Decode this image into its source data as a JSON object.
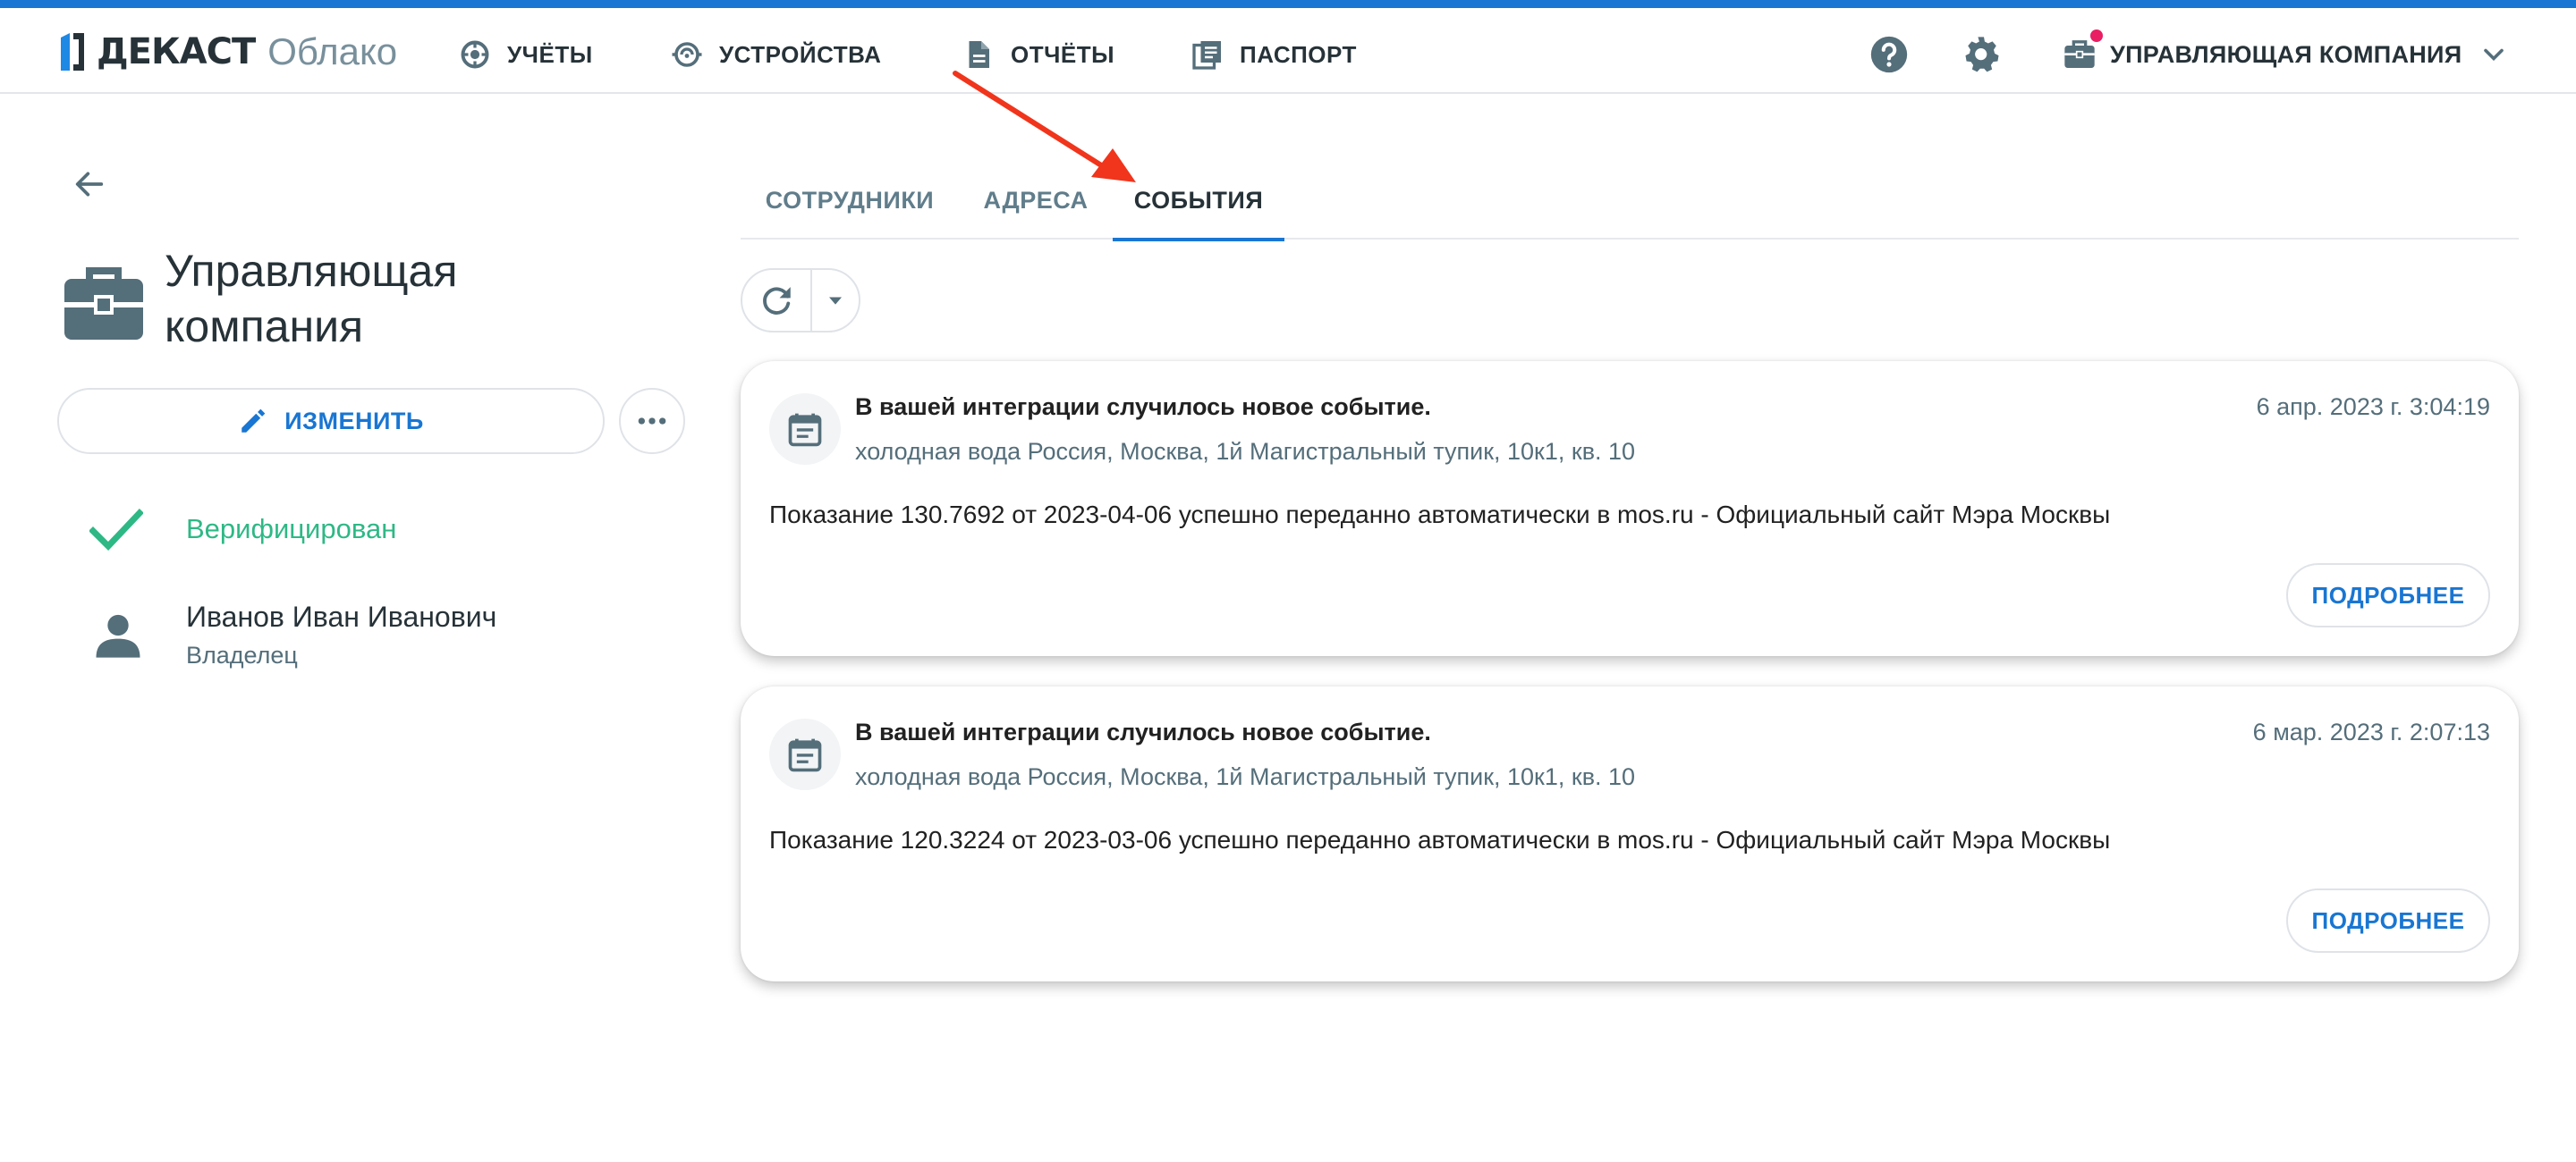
{
  "header": {
    "logo_brand": "ДЕКАСТ",
    "logo_sub": "Облако",
    "nav": [
      {
        "label": "УЧЁТЫ",
        "icon": "meter-icon"
      },
      {
        "label": "УСТРОЙСТВА",
        "icon": "device-icon"
      },
      {
        "label": "ОТЧЁТЫ",
        "icon": "document-icon"
      },
      {
        "label": "ПАСПОРТ",
        "icon": "passport-icon"
      }
    ],
    "help_icon": "help-icon",
    "settings_icon": "gear-icon",
    "account": {
      "label": "УПРАВЛЯЮЩАЯ КОМПАНИЯ",
      "has_notification": true
    }
  },
  "sidebar": {
    "title": "Управляющая компания",
    "edit_label": "ИЗМЕНИТЬ",
    "verified_label": "Верифицирован",
    "person": {
      "name": "Иванов Иван Иванович",
      "role": "Владелец"
    }
  },
  "tabs": [
    {
      "label": "СОТРУДНИКИ",
      "active": false
    },
    {
      "label": "АДРЕСА",
      "active": false
    },
    {
      "label": "СОБЫТИЯ",
      "active": true
    }
  ],
  "events": [
    {
      "title": "В вашей интеграции случилось новое событие.",
      "subtitle": "холодная вода Россия, Москва, 1й Магистральный тупик, 10к1, кв. 10",
      "time": "6 апр. 2023 г. 3:04:19",
      "body": "Показание 130.7692 от 2023-04-06 успешно переданно автоматически в mos.ru - Официальный сайт Мэра Москвы",
      "more_label": "ПОДРОБНЕЕ"
    },
    {
      "title": "В вашей интеграции случилось новое событие.",
      "subtitle": "холодная вода Россия, Москва, 1й Магистральный тупик, 10к1, кв. 10",
      "time": "6 мар. 2023 г. 2:07:13",
      "body": "Показание 120.3224 от 2023-03-06 успешно переданно автоматически в mos.ru - Официальный сайт Мэра Москвы",
      "more_label": "ПОДРОБНЕЕ"
    }
  ],
  "colors": {
    "accent": "#1976d2",
    "text_dark": "#263238",
    "text_muted": "#546e7a",
    "verified": "#2eb886",
    "notification": "#e91e63",
    "annotation_arrow": "#f0351c"
  }
}
